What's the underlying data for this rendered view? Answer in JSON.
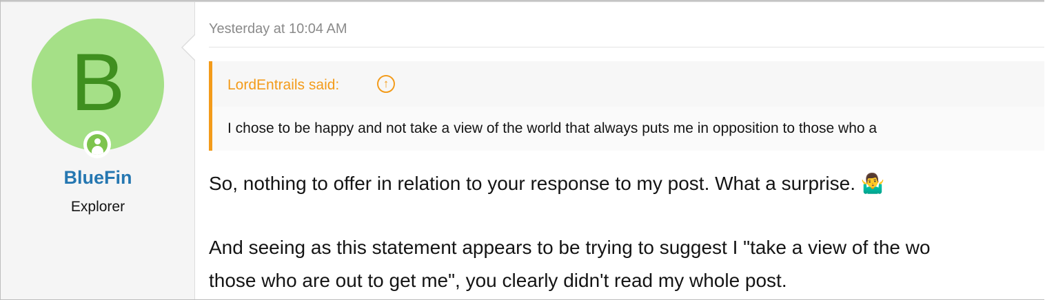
{
  "user": {
    "avatar_letter": "B",
    "username": "BlueFin",
    "title": "Explorer",
    "avatar_color": "#a5e087",
    "status": "online"
  },
  "post": {
    "date": "Yesterday at 10:04 AM",
    "quote": {
      "author": "LordEntrails said:",
      "goto_icon": "arrow-up-circle-icon",
      "text": "I chose to be happy and not take a view of the world that always puts me in opposition to those who a"
    },
    "body": {
      "line1": "So, nothing to offer in relation to your response to my post. What a surprise.",
      "emoji": "🤷‍♂️",
      "line2": "And seeing as this statement appears to be trying to suggest I \"take a view of the wo",
      "line3": "those who are out to get me\", you clearly didn't read my whole post."
    }
  },
  "colors": {
    "quote_accent": "#f39b1a",
    "username": "#2577b1",
    "online": "#7dc44d"
  }
}
